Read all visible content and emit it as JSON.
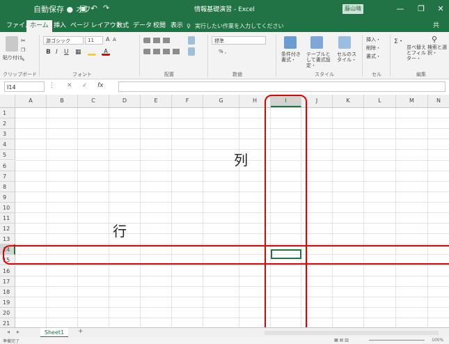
{
  "title_bar": {
    "autosave": "自動保存 ● オフ",
    "title": "情報基礎演習 - Excel",
    "account": "藤山晴一",
    "minimize": "—",
    "restore": "❐",
    "close": "✕"
  },
  "ribbon_tabs": [
    "ファイル",
    "ホーム",
    "挿入",
    "ページ レイアウト",
    "数式",
    "データ",
    "校閲",
    "表示"
  ],
  "tell_me": "実行したい作業を入力してください",
  "share": "共",
  "ribbon": {
    "paste": "貼り付け",
    "font_name": "游ゴシック",
    "font_size": "11",
    "bold": "B",
    "italic": "I",
    "underline": "U",
    "number_format": "標準",
    "number_tools": "% ,",
    "conditional": "条件付き書式・",
    "table": "テーブルとして書式設定・",
    "cellstyle": "セルのスタイル・",
    "insert": "挿入・",
    "delete": "削除・",
    "format": "書式・",
    "sum": "Σ・",
    "sort": "並べ替えとフィルター・",
    "find": "検索と選択・",
    "groups": [
      "クリップボード",
      "フォント",
      "配置",
      "数値",
      "スタイル",
      "セル",
      "編集"
    ]
  },
  "formula_bar": {
    "name_box": "I14",
    "cancel": "✕",
    "enter": "✓",
    "fx": "fx",
    "content": ""
  },
  "columns": [
    "A",
    "B",
    "C",
    "D",
    "E",
    "F",
    "G",
    "H",
    "I",
    "J",
    "K",
    "L",
    "M",
    "N"
  ],
  "rows": [
    "1",
    "2",
    "3",
    "4",
    "5",
    "6",
    "7",
    "8",
    "9",
    "10",
    "11",
    "12",
    "13",
    "14",
    "15",
    "16",
    "17",
    "18",
    "19",
    "20",
    "21"
  ],
  "annotations": {
    "column_label": "列",
    "row_label": "行"
  },
  "sheet_tabs": [
    "Sheet1"
  ],
  "add_sheet": "+",
  "status": "準備完了",
  "zoom": "100%",
  "highlight_color": "#e00000",
  "accent_color": "#217346"
}
